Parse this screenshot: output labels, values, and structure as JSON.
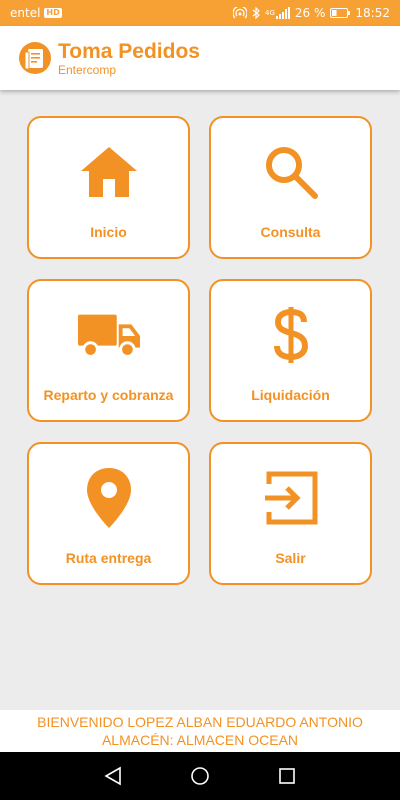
{
  "status_bar": {
    "carrier": "entel",
    "network_badge": "HD",
    "network_type": "4G",
    "battery": "26 %",
    "time": "18:52"
  },
  "app": {
    "title": "Toma Pedidos",
    "subtitle": "Entercomp",
    "logo_icon": "order-list-icon"
  },
  "menu": [
    {
      "label": "Inicio",
      "icon": "home-icon"
    },
    {
      "label": "Consulta",
      "icon": "search-icon"
    },
    {
      "label": "Reparto y cobranza",
      "icon": "truck-icon"
    },
    {
      "label": "Liquidación",
      "icon": "dollar-icon"
    },
    {
      "label": "Ruta entrega",
      "icon": "location-pin-icon"
    },
    {
      "label": "Salir",
      "icon": "exit-icon"
    }
  ],
  "footer": {
    "welcome": "BIENVENIDO LOPEZ ALBAN EDUARDO ANTONIO",
    "warehouse": "ALMACÉN: ALMACEN OCEAN"
  },
  "colors": {
    "accent": "#f39224",
    "status_bar": "#f7a134",
    "background": "#ececec"
  }
}
